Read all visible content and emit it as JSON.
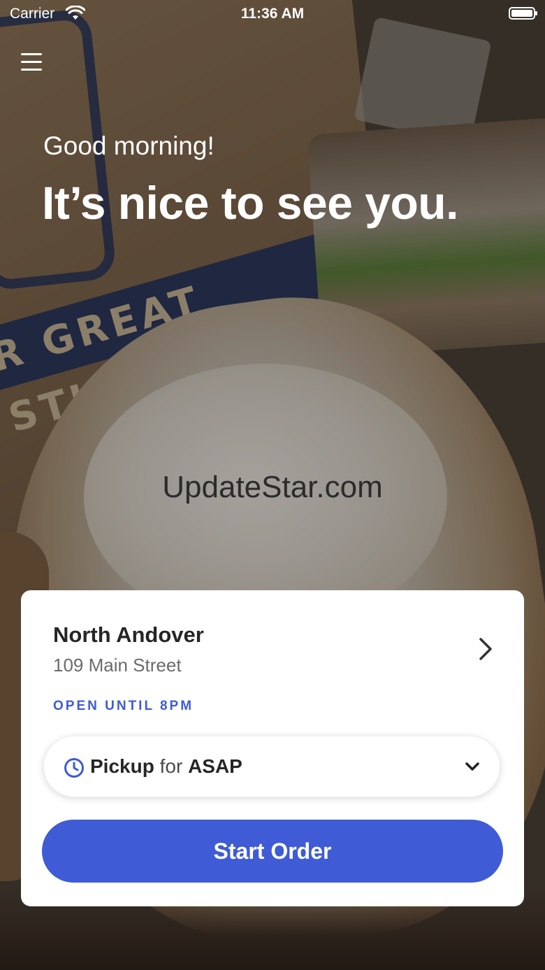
{
  "status_bar": {
    "carrier": "Carrier",
    "time": "11:36 AM"
  },
  "hero": {
    "greeting": "Good morning!",
    "headline": "It’s nice to see you.",
    "bag_text": "R GREAT STUFF"
  },
  "watermark": "UpdateStar.com",
  "store": {
    "name": "North Andover",
    "address": "109 Main Street",
    "open_status": "OPEN UNTIL 8PM"
  },
  "pickup": {
    "mode": "Pickup",
    "connector": "for",
    "time": "ASAP"
  },
  "actions": {
    "start_order": "Start Order"
  },
  "colors": {
    "accent": "#3f5bd6",
    "text_dark": "#262626",
    "text_muted": "#6b6b6b"
  },
  "icons": [
    "menu-icon",
    "wifi-icon",
    "battery-icon",
    "chevron-right-icon",
    "clock-icon",
    "chevron-down-icon"
  ]
}
